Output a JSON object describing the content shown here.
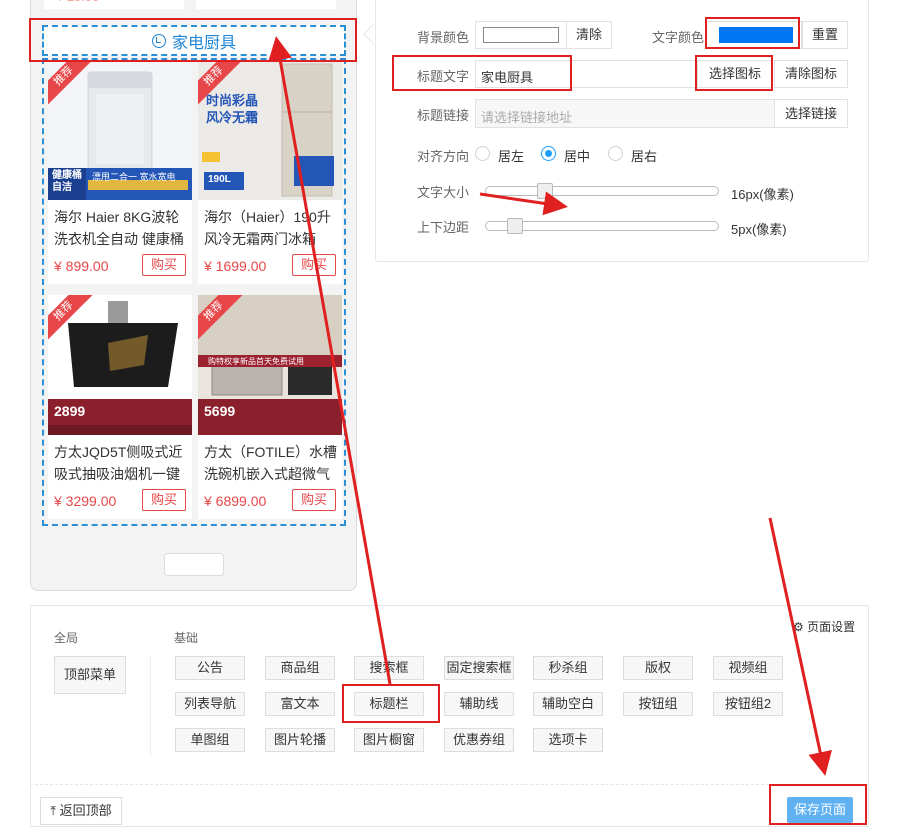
{
  "preview": {
    "title_text": "家电厨具",
    "tag": "推荐",
    "buy": "购买",
    "products": [
      {
        "name": "海尔 Haier 8KG波轮洗衣机全自动 健康桶",
        "price": "¥ 899.00"
      },
      {
        "name": "海尔（Haier）190升风冷无霜两门冰箱",
        "price": "¥ 1699.00"
      },
      {
        "name": "方太JQD5T侧吸式近吸式抽吸油烟机一键",
        "price": "¥ 3299.00"
      },
      {
        "name": "方太（FOTILE）水槽洗碗机嵌入式超微气",
        "price": "¥ 6899.00"
      }
    ],
    "img_texts": {
      "washer_banner": "健康桶自洁",
      "washer_sub": "漂甩二合一 宽水宽电",
      "fridge_t1": "时尚彩晶",
      "fridge_t2": "风冷无霜",
      "fridge_cap": "190L",
      "hood_price": "2899",
      "sink_banner": "购特权享新品首天免费试用",
      "sink_price": "5699"
    }
  },
  "settings": {
    "bg_color_label": "背景颜色",
    "clear": "清除",
    "text_color_label": "文字颜色",
    "text_color_value": "#0075f2",
    "reset": "重置",
    "title_text_label": "标题文字",
    "title_text_value": "家电厨具",
    "choose_icon": "选择图标",
    "clear_icon": "清除图标",
    "title_link_label": "标题链接",
    "title_link_placeholder": "请选择链接地址",
    "choose_link": "选择链接",
    "align_label": "对齐方向",
    "align_options": [
      "居左",
      "居中",
      "居右"
    ],
    "align_selected": "居中",
    "font_size_label": "文字大小",
    "font_size_value": "16px(像素)",
    "font_size_pct": 0.24,
    "margin_label": "上下边距",
    "margin_value": "5px(像素)",
    "margin_pct": 0.1
  },
  "components": {
    "page_settings": "页面设置",
    "global_label": "全局",
    "basic_label": "基础",
    "top_menu": "顶部菜单",
    "row1": [
      "公告",
      "商品组",
      "搜索框",
      "固定搜索框",
      "秒杀组",
      "版权",
      "视频组"
    ],
    "row2": [
      "列表导航",
      "富文本",
      "标题栏",
      "辅助线",
      "辅助空白",
      "按钮组",
      "按钮组2"
    ],
    "row3": [
      "单图组",
      "图片轮播",
      "图片橱窗",
      "优惠券组",
      "选项卡"
    ],
    "back_top": "返回顶部",
    "save_page": "保存页面"
  },
  "colors": {
    "accent": "#1f86d6",
    "price_red": "#e8474a",
    "annotation_red": "#e02020",
    "save_blue": "#5fb1f2"
  }
}
